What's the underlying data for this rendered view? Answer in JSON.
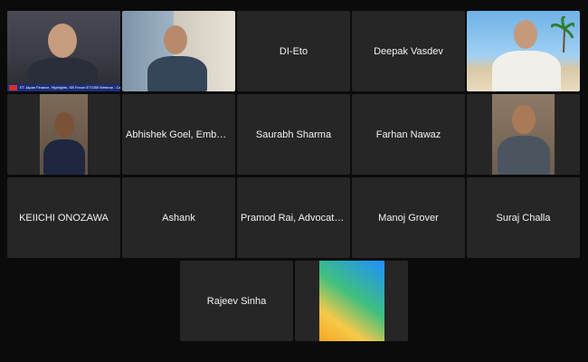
{
  "participants": {
    "r1c1": {
      "ticker": "ET Japan Finance, Highlights, SB Forum ETGSB Webinar - Call to Co"
    },
    "r1c3": {
      "name": "DI-Eto"
    },
    "r1c4": {
      "name": "Deepak Vasdev"
    },
    "r2c2": {
      "name": "Abhishek Goel, Embassy..."
    },
    "r2c3": {
      "name": "Saurabh Sharma"
    },
    "r2c4": {
      "name": "Farhan Nawaz"
    },
    "r3c1": {
      "name": "KEIICHI ONOZAWA"
    },
    "r3c2": {
      "name": "Ashank"
    },
    "r3c3": {
      "name": "Pramod Rai, Advocate (In..."
    },
    "r3c4": {
      "name": "Manoj Grover"
    },
    "r3c5": {
      "name": "Suraj Challa"
    },
    "r4c1": {
      "name": "Rajeev Sinha"
    }
  },
  "colors": {
    "background": "#0b0b0b",
    "tile": "#262626",
    "active_speaker_border": "#2ecc40"
  }
}
